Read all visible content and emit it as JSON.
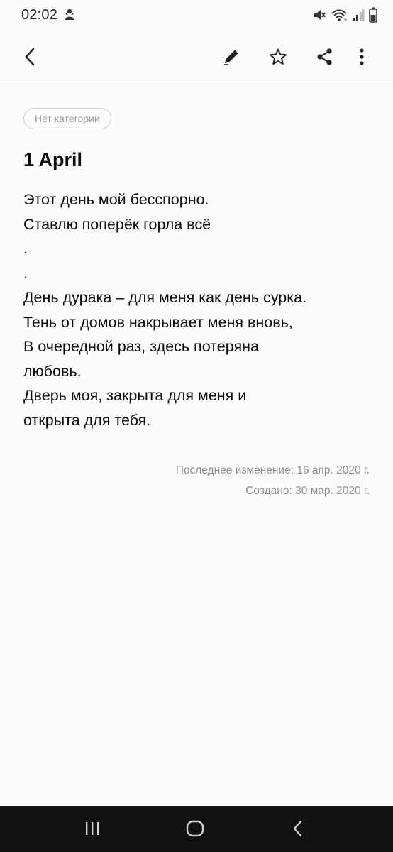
{
  "status_bar": {
    "time": "02:02",
    "icons": [
      "notification-app-icon",
      "mute-icon",
      "wifi-icon",
      "signal-icon",
      "battery-icon"
    ]
  },
  "toolbar": {
    "icons": [
      "back-arrow-icon",
      "pencil-icon",
      "star-icon",
      "share-icon",
      "more-vert-icon"
    ]
  },
  "note": {
    "category": "Нет категории",
    "title": "1 April",
    "lines": [
      "Этот день мой бесспорно.",
      "Ставлю поперёк горла всё",
      ".",
      ".",
      "День дурака – для меня как день сурка.",
      "Тень от домов накрывает меня вновь,",
      "В очередной раз, здесь потеряна",
      "любовь.",
      "Дверь моя, закрыта для меня и",
      "открыта для тебя."
    ],
    "modified": "Последнее изменение: 16 апр. 2020 г.",
    "created": "Создано: 30 мар. 2020 г."
  },
  "nav_bar": {
    "icons": [
      "recent-apps-icon",
      "home-icon",
      "back-icon"
    ]
  },
  "colors": {
    "background": "#fcfcfc",
    "text": "#0b0b0b",
    "meta_text": "#8e8e8e",
    "nav_bar": "#111111"
  }
}
